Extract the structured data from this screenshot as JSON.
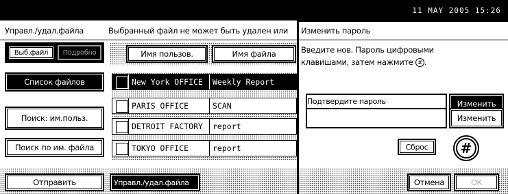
{
  "status_bar": {
    "datetime": "11 MAY  2005 15:26"
  },
  "app": {
    "title": "Управл./удал.файла",
    "message": "Выбранный файл не может быть удален или",
    "tabs": {
      "selected_file": "Выб.файл",
      "detail": "Подробно"
    },
    "columns": {
      "user_name": "Имя пользов.",
      "file_name": "Имя файла"
    },
    "side_buttons": {
      "file_list": "Список файлов",
      "search_user": "Поиск: им.польз.",
      "search_file": "Поиск по им. файла"
    },
    "rows": [
      {
        "user": "New York OFFICE",
        "file": "Weekly Report",
        "selected": true
      },
      {
        "user": "PARIS OFFICE",
        "file": "SCAN",
        "selected": false
      },
      {
        "user": "DETROIT FACTORY",
        "file": "report",
        "selected": false
      },
      {
        "user": "TOKYO OFFICE",
        "file": "report",
        "selected": false
      }
    ],
    "bottom": {
      "send": "Отправить",
      "manage_tab": "Управл./удал.файла"
    }
  },
  "dialog": {
    "title": "Изменить пароль",
    "instruction_line1": "Введите нов. Пароль цифровыми",
    "instruction_line2": "клавишами, затем нажмите",
    "instruction_key": "#",
    "instruction_end": ".",
    "change_button": "Изменить",
    "confirm_label": "Подтвердите пароль",
    "change_button_2": "Изменить",
    "reset_button": "Сброс",
    "hash_key": "#",
    "cancel_button": "Отмена",
    "ok_button": "ОК"
  }
}
